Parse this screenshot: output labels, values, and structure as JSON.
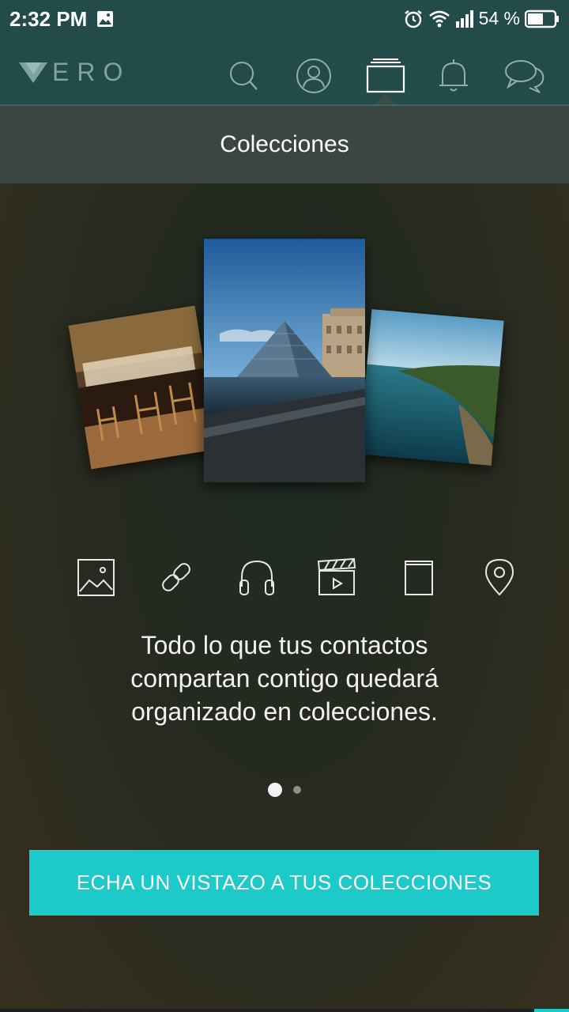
{
  "status_bar": {
    "time": "2:32 PM",
    "battery": "54 %",
    "icons": [
      "gallery-icon",
      "alarm-icon",
      "wifi-icon",
      "signal-icon",
      "battery-icon"
    ]
  },
  "header": {
    "logo": "ERO",
    "nav": [
      "search-icon",
      "profile-icon",
      "collections-icon",
      "notifications-icon",
      "chat-icon"
    ],
    "active_nav": "collections-icon",
    "accent_color": "#234b49"
  },
  "section": {
    "title": "Colecciones"
  },
  "carousel": {
    "photos": [
      "restaurant-photo",
      "louvre-pyramid-photo",
      "coast-photo"
    ]
  },
  "categories": [
    "photo-icon",
    "link-icon",
    "music-icon",
    "movie-icon",
    "book-icon",
    "place-icon"
  ],
  "description": {
    "line1": "Todo lo que tus contactos",
    "line2": "compartan contigo quedará",
    "line3": "organizado en colecciones."
  },
  "pagination": {
    "current": 1,
    "total": 2
  },
  "cta": {
    "label": "ECHA UN VISTAZO A TUS COLECCIONES",
    "color": "#1ec9c9"
  }
}
